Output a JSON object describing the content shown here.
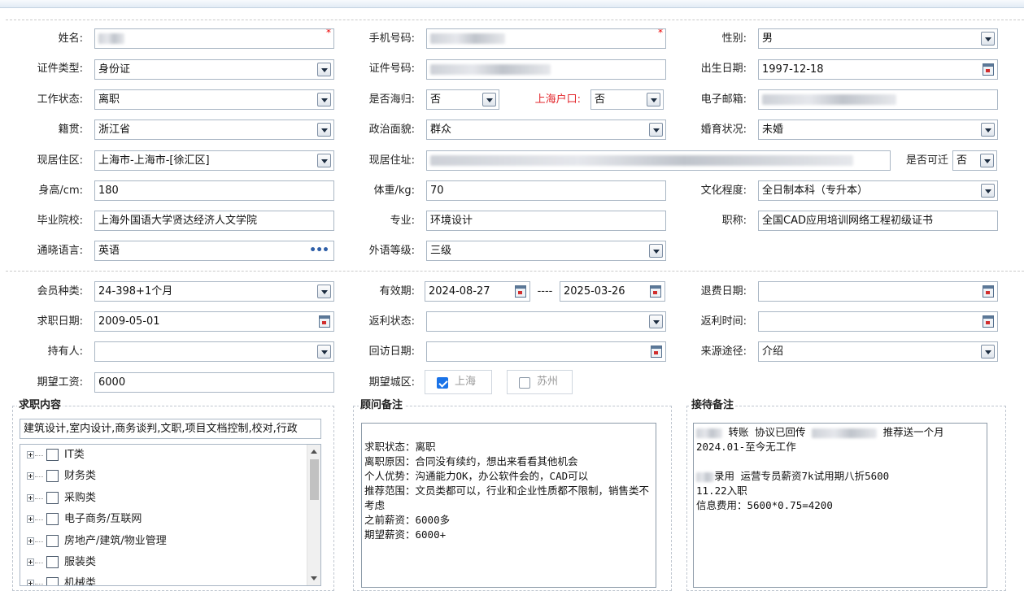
{
  "basic": {
    "name_label": "姓名:",
    "mobile_label": "手机号码:",
    "gender_label": "性别:",
    "gender_value": "男",
    "idtype_label": "证件类型:",
    "idtype_value": "身份证",
    "idno_label": "证件号码:",
    "birth_label": "出生日期:",
    "birth_value": "1997-12-18",
    "workstatus_label": "工作状态:",
    "workstatus_value": "离职",
    "overseas_label": "是否海归:",
    "overseas_value": "否",
    "shhukou_label": "上海户口:",
    "shhukou_value": "否",
    "email_label": "电子邮箱:",
    "native_label": "籍贯:",
    "native_value": "浙江省",
    "political_label": "政治面貌:",
    "political_value": "群众",
    "marital_label": "婚育状况:",
    "marital_value": "未婚",
    "district_label": "现居住区:",
    "district_value": "上海市-上海市-[徐汇区]",
    "address_label": "现居住址:",
    "relocate_label": "是否可迁",
    "relocate_value": "否",
    "height_label": "身高/cm:",
    "height_value": "180",
    "weight_label": "体重/kg:",
    "weight_value": "70",
    "education_label": "文化程度:",
    "education_value": "全日制本科（专升本）",
    "school_label": "毕业院校:",
    "school_value": "上海外国语大学贤达经济人文学院",
    "major_label": "专业:",
    "major_value": "环境设计",
    "title_label": "职称:",
    "title_value": "全国CAD应用培训网络工程初级证书",
    "language_label": "通晓语言:",
    "language_value": "英语",
    "language_more": "•••",
    "langlevel_label": "外语等级:",
    "langlevel_value": "三级"
  },
  "member": {
    "type_label": "会员种类:",
    "type_value": "24-398+1个月",
    "valid_label": "有效期:",
    "valid_from": "2024-08-27",
    "valid_sep": "----",
    "valid_to": "2025-03-26",
    "refund_label": "退费日期:",
    "jobdate_label": "求职日期:",
    "jobdate_value": "2009-05-01",
    "rebate_label": "返利状态:",
    "rebatetime_label": "返利时间:",
    "holder_label": "持有人:",
    "revisit_label": "回访日期:",
    "source_label": "来源途径:",
    "source_value": "介绍",
    "salary_label": "期望工资:",
    "salary_value": "6000",
    "city_label": "期望城区:",
    "city_shanghai": "上海",
    "city_suzhou": "苏州"
  },
  "job_content": {
    "title": "求职内容",
    "summary": "建筑设计,室内设计,商务谈判,文职,项目文档控制,校对,行政",
    "categories": [
      "IT类",
      "财务类",
      "采购类",
      "电子商务/互联网",
      "房地产/建筑/物业管理",
      "服装类",
      "机械类"
    ]
  },
  "advisor_notes": {
    "title": "顾问备注",
    "lines": [
      "",
      "求职状态：离职",
      "离职原因：合同没有续约，想出来看看其他机会",
      "个人优势：沟通能力OK，办公软件会的，CAD可以",
      "推荐范围：文员类都可以，行业和企业性质都不限制，销售类不考虑",
      "之前薪资：6000多",
      "期望薪资：6000+"
    ]
  },
  "reception_notes": {
    "title": "接待备注",
    "line1_a": "转账 协议已回传",
    "line1_b": "推荐送一个月",
    "line2": "2024.01-至今无工作",
    "line3": "",
    "line4": "录用 运营专员薪资7k试用期八折5600",
    "line5": "11.22入职",
    "line6": "信息费用：5600*0.75=4200"
  },
  "required_mark": "*"
}
